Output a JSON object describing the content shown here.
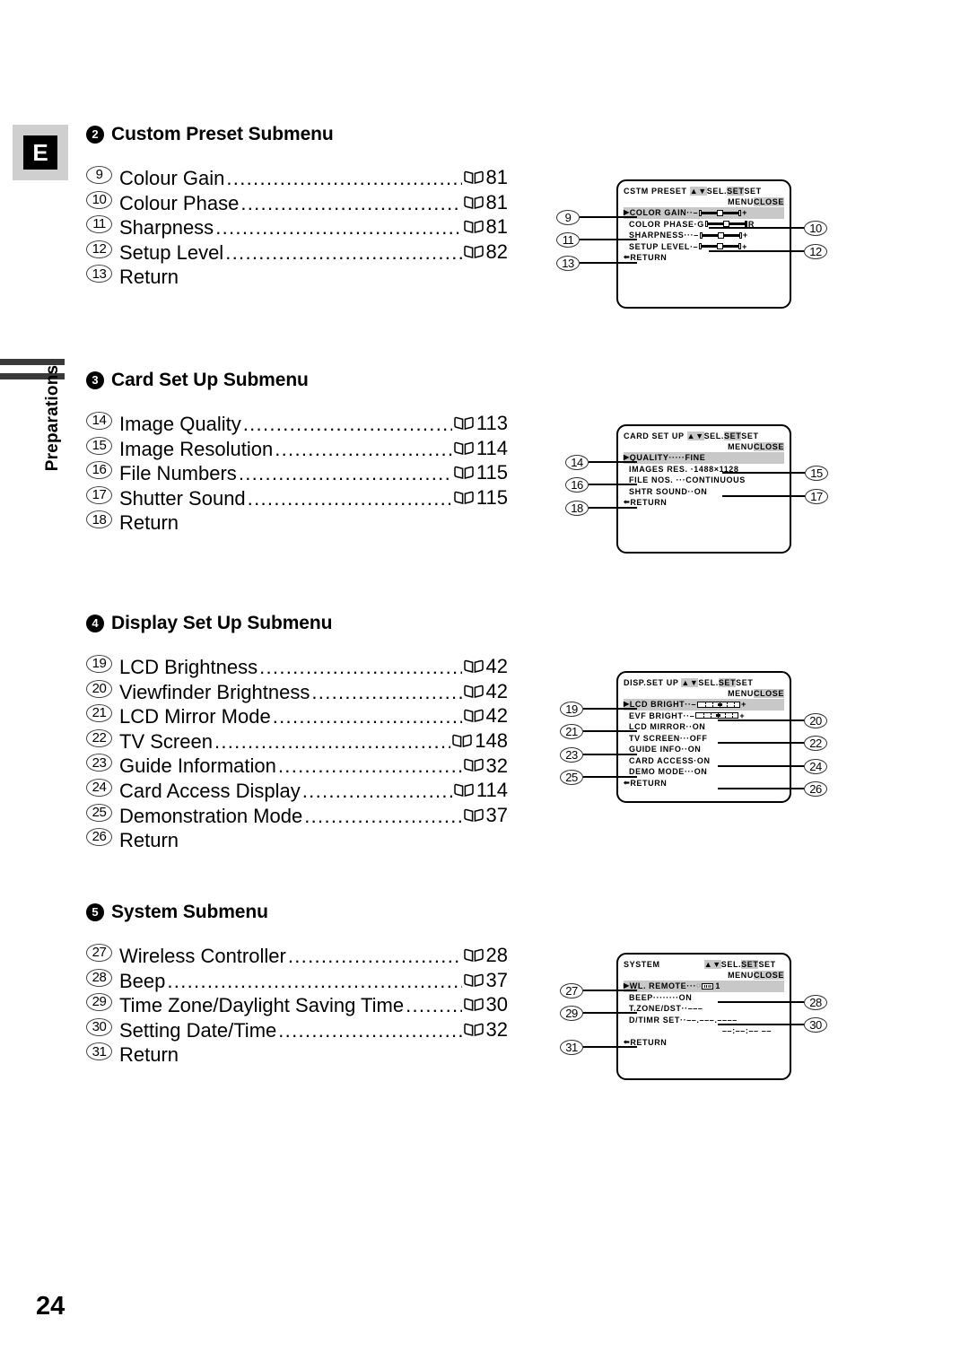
{
  "page": {
    "language_badge": "E",
    "section_tab": "Preparations",
    "number": "24"
  },
  "icons": {
    "book": "book-icon",
    "caret_right": "▶",
    "return_arrow": "←",
    "up_down": "▲▼"
  },
  "sections": [
    {
      "bullet": "2",
      "title": "Custom Preset Submenu",
      "items": [
        {
          "num": "9",
          "label": "Colour Gain",
          "page": "81"
        },
        {
          "num": "10",
          "label": "Colour Phase",
          "page": "81"
        },
        {
          "num": "11",
          "label": "Sharpness",
          "page": "81"
        },
        {
          "num": "12",
          "label": "Setup Level",
          "page": "82"
        },
        {
          "num": "13",
          "label": "Return",
          "page": ""
        }
      ]
    },
    {
      "bullet": "3",
      "title": "Card Set Up Submenu",
      "items": [
        {
          "num": "14",
          "label": "Image Quality",
          "page": "113"
        },
        {
          "num": "15",
          "label": "Image Resolution",
          "page": "114"
        },
        {
          "num": "16",
          "label": "File Numbers",
          "page": "115"
        },
        {
          "num": "17",
          "label": "Shutter Sound",
          "page": "115"
        },
        {
          "num": "18",
          "label": "Return",
          "page": ""
        }
      ]
    },
    {
      "bullet": "4",
      "title": "Display Set Up Submenu",
      "items": [
        {
          "num": "19",
          "label": "LCD Brightness",
          "page": "42"
        },
        {
          "num": "20",
          "label": "Viewfinder Brightness",
          "page": "42"
        },
        {
          "num": "21",
          "label": "LCD Mirror Mode",
          "page": "42"
        },
        {
          "num": "22",
          "label": "TV Screen",
          "page": "148"
        },
        {
          "num": "23",
          "label": "Guide Information",
          "page": "32"
        },
        {
          "num": "24",
          "label": "Card Access Display",
          "page": "114"
        },
        {
          "num": "25",
          "label": "Demonstration Mode",
          "page": "37"
        },
        {
          "num": "26",
          "label": "Return",
          "page": ""
        }
      ]
    },
    {
      "bullet": "5",
      "title": "System Submenu",
      "items": [
        {
          "num": "27",
          "label": "Wireless Controller",
          "page": "28"
        },
        {
          "num": "28",
          "label": "Beep",
          "page": "37"
        },
        {
          "num": "29",
          "label": "Time Zone/Daylight Saving Time",
          "page": "30"
        },
        {
          "num": "30",
          "label": "Setting Date/Time",
          "page": "32"
        },
        {
          "num": "31",
          "label": "Return",
          "page": ""
        }
      ]
    }
  ],
  "screens": {
    "custom_preset": {
      "title": "CSTM PRESET",
      "hint_updown": "▲▼",
      "hint_sel": "SEL.",
      "hint_set1": "SET",
      "hint_set2": "SET",
      "hint_menu": "MENU",
      "hint_close": "CLOSE",
      "rows": [
        {
          "label": "COLOR GAIN··–",
          "suffix": "+",
          "type": "bar-cp"
        },
        {
          "label": "COLOR PHASE·G",
          "suffix": "R",
          "type": "bar-cp"
        },
        {
          "label": "SHARPNESS···–",
          "suffix": "+",
          "type": "bar-cp"
        },
        {
          "label": "SETUP LEVEL·–",
          "suffix": "+",
          "type": "bar-cp"
        },
        {
          "label": "RETURN",
          "suffix": "",
          "type": "return"
        }
      ]
    },
    "card_set_up": {
      "title": "CARD SET UP",
      "hint_updown": "▲▼",
      "hint_sel": "SEL.",
      "hint_set1": "SET",
      "hint_set2": "SET",
      "hint_menu": "MENU",
      "hint_close": "CLOSE",
      "rows": [
        {
          "label": "QUALITY·····FINE",
          "type": "text"
        },
        {
          "label": "IMAGES RES. ·1488×1128",
          "type": "text"
        },
        {
          "label": "FILE NOS. ···CONTINUOUS",
          "type": "text"
        },
        {
          "label": "SHTR SOUND··ON",
          "type": "text"
        },
        {
          "label": "RETURN",
          "type": "return"
        }
      ]
    },
    "display_set_up": {
      "title": "DISP.SET UP",
      "hint_updown": "▲▼",
      "hint_sel": "SEL.",
      "hint_set1": "SET",
      "hint_set2": "SET",
      "hint_menu": "MENU",
      "hint_close": "CLOSE",
      "rows": [
        {
          "label": "LCD BRIGHT··–",
          "suffix": "+",
          "type": "bar-br"
        },
        {
          "label": "EVF BRIGHT··–",
          "suffix": "+",
          "type": "bar-br"
        },
        {
          "label": "LCD MIRROR··ON",
          "type": "text"
        },
        {
          "label": "TV SCREEN···OFF",
          "type": "text"
        },
        {
          "label": "GUIDE INFO··ON",
          "type": "text"
        },
        {
          "label": "CARD ACCESS·ON",
          "type": "text"
        },
        {
          "label": "DEMO MODE···ON",
          "type": "text"
        },
        {
          "label": "RETURN",
          "type": "return"
        }
      ]
    },
    "system": {
      "title": "SYSTEM",
      "hint_updown": "▲▼",
      "hint_sel": "SEL.",
      "hint_set1": "SET",
      "hint_set2": "SET",
      "hint_menu": "MENU",
      "hint_close": "CLOSE",
      "rows": [
        {
          "label": "WL. REMOTE···",
          "suffix": "1",
          "type": "wl"
        },
        {
          "label": "BEEP········ON",
          "type": "text"
        },
        {
          "label": "T.ZONE/DST··–––",
          "type": "text"
        },
        {
          "label": "D/TIMR SET··––.–––.––––",
          "type": "text"
        },
        {
          "label": "––:––:––  ––",
          "type": "textright"
        },
        {
          "label": "RETURN",
          "type": "return"
        }
      ]
    }
  }
}
